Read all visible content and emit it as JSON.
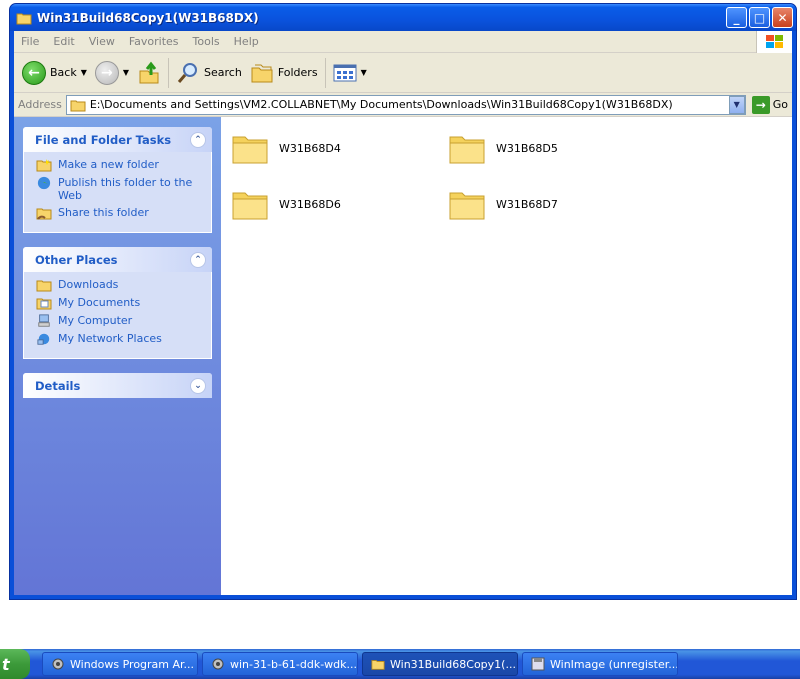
{
  "window": {
    "title": "Win31Build68Copy1(W31B68DX)",
    "controls": {
      "minimize": "_",
      "maximize": "□",
      "close": "✕"
    }
  },
  "menubar": {
    "items": [
      "File",
      "Edit",
      "View",
      "Favorites",
      "Tools",
      "Help"
    ]
  },
  "toolbar": {
    "back_label": "Back",
    "search_label": "Search",
    "folders_label": "Folders"
  },
  "address": {
    "label": "Address",
    "path": "E:\\Documents and Settings\\VM2.COLLABNET\\My Documents\\Downloads\\Win31Build68Copy1(W31B68DX)",
    "go_label": "Go"
  },
  "taskpane": {
    "file_tasks": {
      "title": "File and Folder Tasks",
      "items": [
        "Make a new folder",
        "Publish this folder to the Web",
        "Share this folder"
      ]
    },
    "other_places": {
      "title": "Other Places",
      "items": [
        "Downloads",
        "My Documents",
        "My Computer",
        "My Network Places"
      ]
    },
    "details": {
      "title": "Details"
    }
  },
  "files": [
    "W31B68D4",
    "W31B68D5",
    "W31B68D6",
    "W31B68D7"
  ],
  "taskbar": {
    "start_label": "t",
    "buttons": [
      "Windows Program Ar...",
      "win-31-b-61-ddk-wdk...",
      "Win31Build68Copy1(...",
      "WinImage (unregister..."
    ]
  },
  "colors": {
    "title_blue": "#0A4FD8",
    "task_link": "#215DC6",
    "pane_bg": "#6375D6",
    "chrome": "#ECE9D8"
  }
}
